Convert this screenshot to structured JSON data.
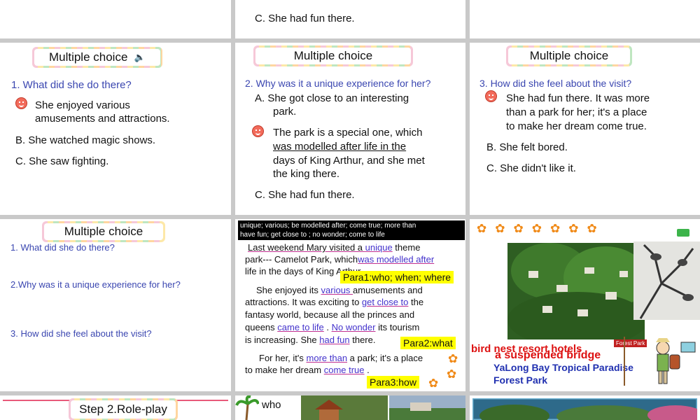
{
  "slideA1": {
    "line": "C. She had fun there."
  },
  "slideB": {
    "title": "Multiple choice",
    "question": "1. What did she do there?",
    "optA_1": "She enjoyed various",
    "optA_2": "amusements and attractions.",
    "optB": "B. She watched magic shows.",
    "optC": "C. She saw fighting."
  },
  "slideC": {
    "title": "Multiple choice",
    "question": "2. Why was it a unique experience for her?",
    "optA_1": "A. She got close to an interesting",
    "optA_2": "park.",
    "optB_1": "The park is a special one, which",
    "optB_2": "was modelled after life in the",
    "optB_3": "days of King Arthur, and she met",
    "optB_4": "the king there.",
    "optC": "C. She had fun there."
  },
  "slideD": {
    "title": "Multiple choice",
    "question": "3. How did she feel about the visit?",
    "optA_1": "She had fun there. It was more",
    "optA_2": "than a park for her; it's a place",
    "optA_3": "to make her dream come true.",
    "optB": "B. She felt bored.",
    "optC": "C. She didn't like it."
  },
  "slideE": {
    "title": "Multiple choice",
    "q1": "1. What did she do there?",
    "q2": "2.Why was it a unique experience for her?",
    "q3": "3. How did she feel about the visit?"
  },
  "slideF": {
    "wordbank_1": "unique;  various;  be modelled after;  come true; more than",
    "wordbank_2": "have fun;  get close to ;  no wonder;   come to life",
    "p1_l1a": "Last weekend Mary visited a ",
    "p1_l1b": "unique",
    "p1_l1c": " theme",
    "p1_l2a": "park--- Camelot Park, which",
    "p1_l2b": "was modelled after",
    "p1_l3": "life in the days of King Arthur.",
    "para1": "Para1:who; when; where",
    "p2_l1a": "She enjoyed its ",
    "p2_l1b": "various ",
    "p2_l1c": "amusements and",
    "p2_l2a": "attractions. It was exciting to ",
    "p2_l2b": "get close to",
    "p2_l2c": " the",
    "p2_l3": "fantasy world,  because all the princes and",
    "p2_l4a": "queens ",
    "p2_l4b": "came to life",
    "p2_l4c": " . ",
    "p2_l4d": "No wonder",
    "p2_l4e": " its tourism",
    "p2_l5a": "is increasing.  She ",
    "p2_l5b": "had fun",
    "p2_l5c": " there.",
    "para2": "Para2:what",
    "p3_l1a": "For her, it's ",
    "p3_l1b": "more than",
    "p3_l1c": " a park; it's a place",
    "p3_l2a": "to make her dream ",
    "p3_l2b": "come true",
    "p3_l2c": " .",
    "para3": "Para3:how"
  },
  "slideG": {
    "caption_red": "bird nest resort hotels",
    "caption_bridge": "a suspended bridge",
    "caption_blue1": "YaLong Bay Tropical Paradise",
    "caption_blue2": "Forest Park",
    "sign": "Forest Park"
  },
  "slideH": {
    "title": "Step 2.Role-play"
  },
  "slideI": {
    "label": "who"
  }
}
